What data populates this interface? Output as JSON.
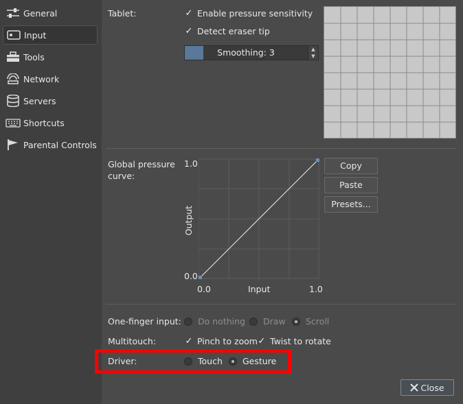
{
  "sidebar": {
    "items": [
      {
        "label": "General",
        "icon": "sliders-icon",
        "active": false
      },
      {
        "label": "Input",
        "icon": "tablet-icon",
        "active": true
      },
      {
        "label": "Tools",
        "icon": "toolbox-icon",
        "active": false
      },
      {
        "label": "Network",
        "icon": "network-icon",
        "active": false
      },
      {
        "label": "Servers",
        "icon": "database-icon",
        "active": false
      },
      {
        "label": "Shortcuts",
        "icon": "keyboard-icon",
        "active": false
      },
      {
        "label": "Parental Controls",
        "icon": "flag-icon",
        "active": false
      }
    ]
  },
  "tablet": {
    "label": "Tablet:",
    "pressure_label": "Enable pressure sensitivity",
    "eraser_label": "Detect eraser tip",
    "smoothing_text": "Smoothing: 3",
    "smoothing_level": 0.15
  },
  "curve": {
    "label": "Global pressure curve:",
    "y_max": "1.0",
    "y_min": "0.0",
    "x_min": "0.0",
    "x_max": "1.0",
    "x_label": "Input",
    "y_label": "Output",
    "copy": "Copy",
    "paste": "Paste",
    "presets": "Presets..."
  },
  "one_finger": {
    "label": "One-finger input:",
    "options": [
      "Do nothing",
      "Draw",
      "Scroll"
    ],
    "selected": "Scroll"
  },
  "multitouch": {
    "label": "Multitouch:",
    "pinch": "Pinch to zoom",
    "twist": "Twist to rotate"
  },
  "driver": {
    "label": "Driver:",
    "options": [
      "Touch",
      "Gesture"
    ],
    "selected": "Gesture"
  },
  "close_label": "Close",
  "colors": {
    "highlight": "#ff0000",
    "accent": "#5a7898"
  }
}
